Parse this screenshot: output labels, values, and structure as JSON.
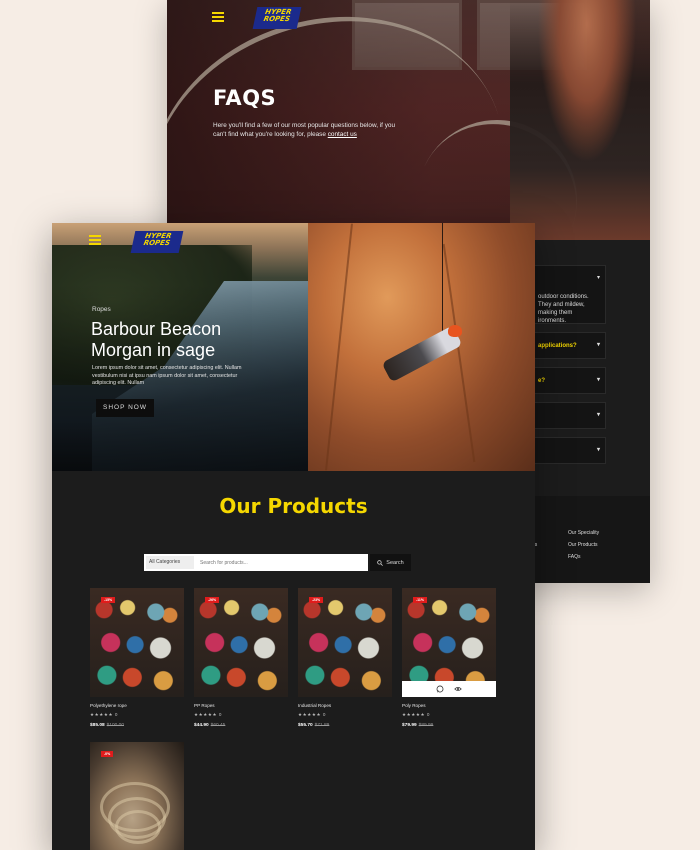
{
  "faq_page": {
    "logo_text": "HYPER ROPES",
    "title": "FAQS",
    "intro": "Here you'll find a few of our most popular questions below, if you can't find what you're looking for, please",
    "intro_link": "contact us",
    "faq_items": [
      {
        "text": "outdoor conditions. They and mildew, making them ironments.",
        "open": true
      },
      {
        "text": "applications?",
        "open": false
      },
      {
        "text": "e?",
        "open": false
      },
      {
        "text": "",
        "open": false
      },
      {
        "text": "",
        "open": false
      }
    ],
    "footer": {
      "col1": [
        "s",
        "ds"
      ],
      "col2": [
        "Our Speciality",
        "Our Products",
        "FAQs"
      ]
    }
  },
  "shop_page": {
    "logo_text": "HYPER ROPES",
    "hero": {
      "eyebrow": "Ropes",
      "title_line1": "Barbour Beacon",
      "title_line2": "Morgan in sage",
      "copy": "Lorem ipsum dolor sit amet, consectetur adipiscing elit. Nullam vestibulum nisi at ipsu nam ipsum dolor sit amet, consectetur adipiscing elit. Nullam",
      "button_label": "SHOP NOW"
    },
    "products_title": "Our Products",
    "search": {
      "category": "All Categories",
      "placeholder": "Search for products...",
      "button_label": "Search"
    },
    "products": [
      {
        "name": "Polyethylene rope",
        "rating": "★★★★★ 0",
        "price": "$85.08",
        "old_price": "$100.00",
        "badge": "-15%"
      },
      {
        "name": "PP Ropes",
        "rating": "★★★★★ 0",
        "price": "$44.90",
        "old_price": "$60.45",
        "badge": "-26%"
      },
      {
        "name": "Industrial Ropes",
        "rating": "★★★★★ 0",
        "price": "$55.70",
        "old_price": "$71.89",
        "badge": "-23%"
      },
      {
        "name": "Poly Ropes",
        "rating": "★★★★★ 0",
        "price": "$79.99",
        "old_price": "$89.99",
        "badge": "-11%"
      },
      {
        "name": "",
        "rating": "",
        "price": "",
        "old_price": "",
        "badge": "-0%"
      }
    ]
  },
  "colors": {
    "background": "#f6ede5",
    "card_bg": "#1c1c1c",
    "accent_yellow": "#f5d700",
    "logo_blue": "#1b2a8c",
    "sale_red": "#e01c1c"
  },
  "icons": {
    "menu": "hamburger-icon",
    "search": "magnifier-icon",
    "chevron": "chevron-down-icon",
    "whatsapp": "whatsapp-icon",
    "view": "eye-icon"
  }
}
